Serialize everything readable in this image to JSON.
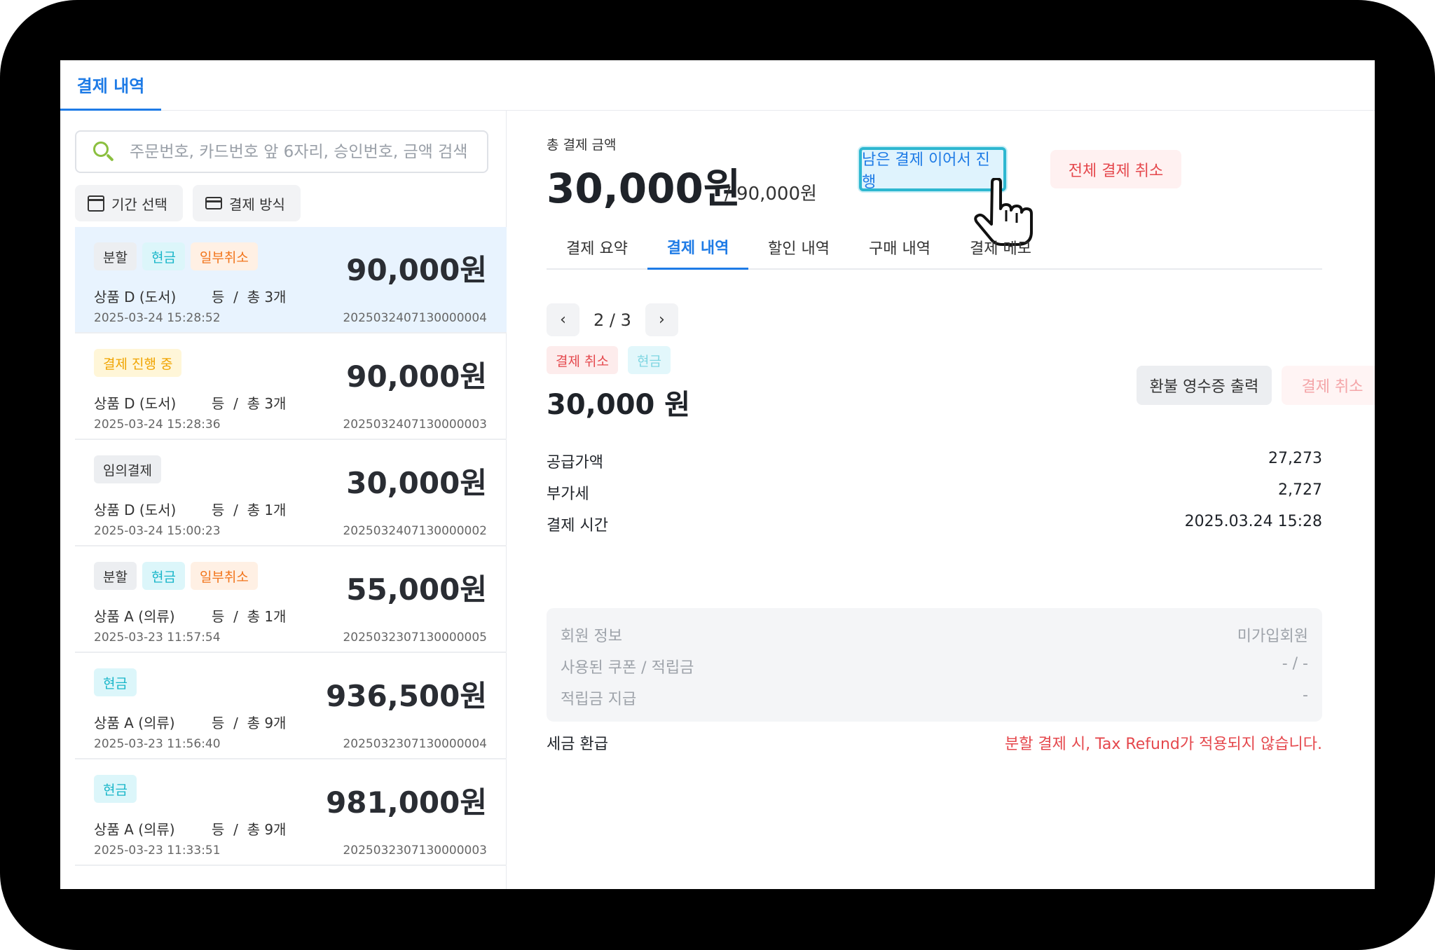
{
  "top_tab": {
    "label": "결제 내역"
  },
  "search": {
    "placeholder": "주문번호, 카드번호 앞 6자리, 승인번호, 금액 검색"
  },
  "filters": {
    "period": "기간 선택",
    "method": "결제 방식"
  },
  "list": [
    {
      "badges": [
        {
          "text": "분할",
          "style": "gray"
        },
        {
          "text": "현금",
          "style": "cyan"
        },
        {
          "text": "일부취소",
          "style": "orange"
        }
      ],
      "amount": "90,000원",
      "product": "상품 D (도서)",
      "count": "등  /  총 3개",
      "date": "2025-03-24 15:28:52",
      "order": "2025032407130000004",
      "selected": true
    },
    {
      "badges": [
        {
          "text": "결제 진행 중",
          "style": "yellow"
        }
      ],
      "amount": "90,000원",
      "product": "상품 D (도서)",
      "count": "등  /  총 3개",
      "date": "2025-03-24 15:28:36",
      "order": "2025032407130000003",
      "selected": false
    },
    {
      "badges": [
        {
          "text": "임의결제",
          "style": "gray"
        }
      ],
      "amount": "30,000원",
      "product": "상품 D (도서)",
      "count": "등  /  총 1개",
      "date": "2025-03-24 15:00:23",
      "order": "2025032407130000002",
      "selected": false
    },
    {
      "badges": [
        {
          "text": "분할",
          "style": "gray"
        },
        {
          "text": "현금",
          "style": "cyan"
        },
        {
          "text": "일부취소",
          "style": "orange"
        }
      ],
      "amount": "55,000원",
      "product": "상품 A (의류)",
      "count": "등  /  총 1개",
      "date": "2025-03-23 11:57:54",
      "order": "2025032307130000005",
      "selected": false
    },
    {
      "badges": [
        {
          "text": "현금",
          "style": "cyan"
        }
      ],
      "amount": "936,500원",
      "product": "상품 A (의류)",
      "count": "등  /  총 9개",
      "date": "2025-03-23 11:56:40",
      "order": "2025032307130000004",
      "selected": false
    },
    {
      "badges": [
        {
          "text": "현금",
          "style": "cyan"
        }
      ],
      "amount": "981,000원",
      "product": "상품 A (의류)",
      "count": "등  /  총 9개",
      "date": "2025-03-23 11:33:51",
      "order": "2025032307130000003",
      "selected": false
    }
  ],
  "detail": {
    "total_label": "총 결제 금액",
    "total_amount": "30,000원",
    "total_of": "/  90,000원",
    "continue_button": "남은 결제 이어서 진행",
    "cancel_all_button": "전체 결제 취소",
    "tabs": [
      "결제 요약",
      "결제 내역",
      "할인 내역",
      "구매 내역",
      "결제 메모"
    ],
    "active_tab": 1,
    "pager": {
      "prev": "‹",
      "text": "2 / 3",
      "next": "›"
    },
    "status_badges": {
      "cancel": "결제 취소",
      "cash": "현금"
    },
    "amount": "30,000 원",
    "receipt_button": "환불 영수증 출력",
    "cancel_button": "결제 취소",
    "rows": [
      {
        "label": "공급가액",
        "value": "27,273"
      },
      {
        "label": "부가세",
        "value": "2,727"
      },
      {
        "label": "결제 시간",
        "value": "2025.03.24 15:28"
      }
    ],
    "member": [
      {
        "label": "회원 정보",
        "value": "미가입회원"
      },
      {
        "label": "사용된 쿠폰 / 적립금",
        "value": "-  /  -"
      },
      {
        "label": "적립금 지급",
        "value": "-"
      }
    ],
    "tax": {
      "label": "세금 환급",
      "note": "분할 결제 시, Tax Refund가 적용되지 않습니다."
    }
  },
  "colors": {
    "accent": "#1e7be6",
    "danger": "#e5484d",
    "highlight": "#2db7d0"
  }
}
